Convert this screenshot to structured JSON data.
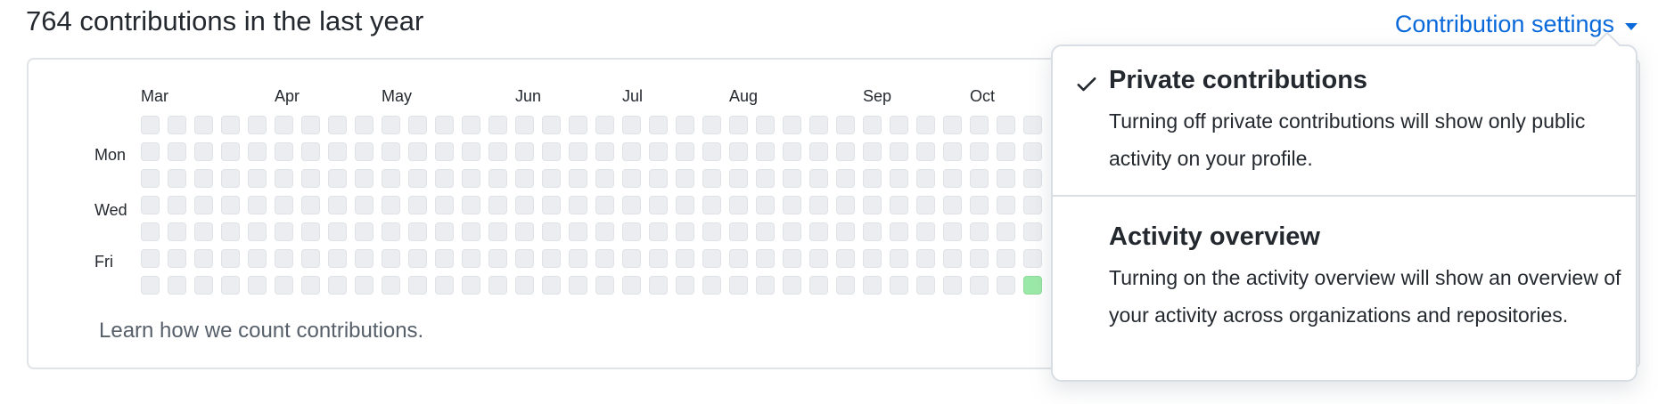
{
  "header": {
    "title": "764 contributions in the last year",
    "settings_label": "Contribution settings"
  },
  "graph": {
    "months": [
      "Mar",
      "Apr",
      "May",
      "Jun",
      "Jul",
      "Aug",
      "Sep",
      "Oct"
    ],
    "days": [
      "Mon",
      "Wed",
      "Fri"
    ],
    "weeks_visible": 34,
    "days_per_week": 7,
    "cell_levels": {
      "default": 0,
      "highlighted": [
        {
          "week": 33,
          "day": 6,
          "level": 1
        }
      ]
    },
    "learn_link": "Learn how we count contributions."
  },
  "colors": {
    "empty_cell": "#ebedf0",
    "level1_cell": "#9be9a8",
    "link": "#0969da"
  },
  "dropdown": {
    "items": [
      {
        "title": "Private contributions",
        "description": "Turning off private contributions will show only public activity on your profile.",
        "checked": true
      },
      {
        "title": "Activity overview",
        "description": "Turning on the activity overview will show an overview of your activity across organizations and repositories.",
        "checked": false
      }
    ]
  }
}
